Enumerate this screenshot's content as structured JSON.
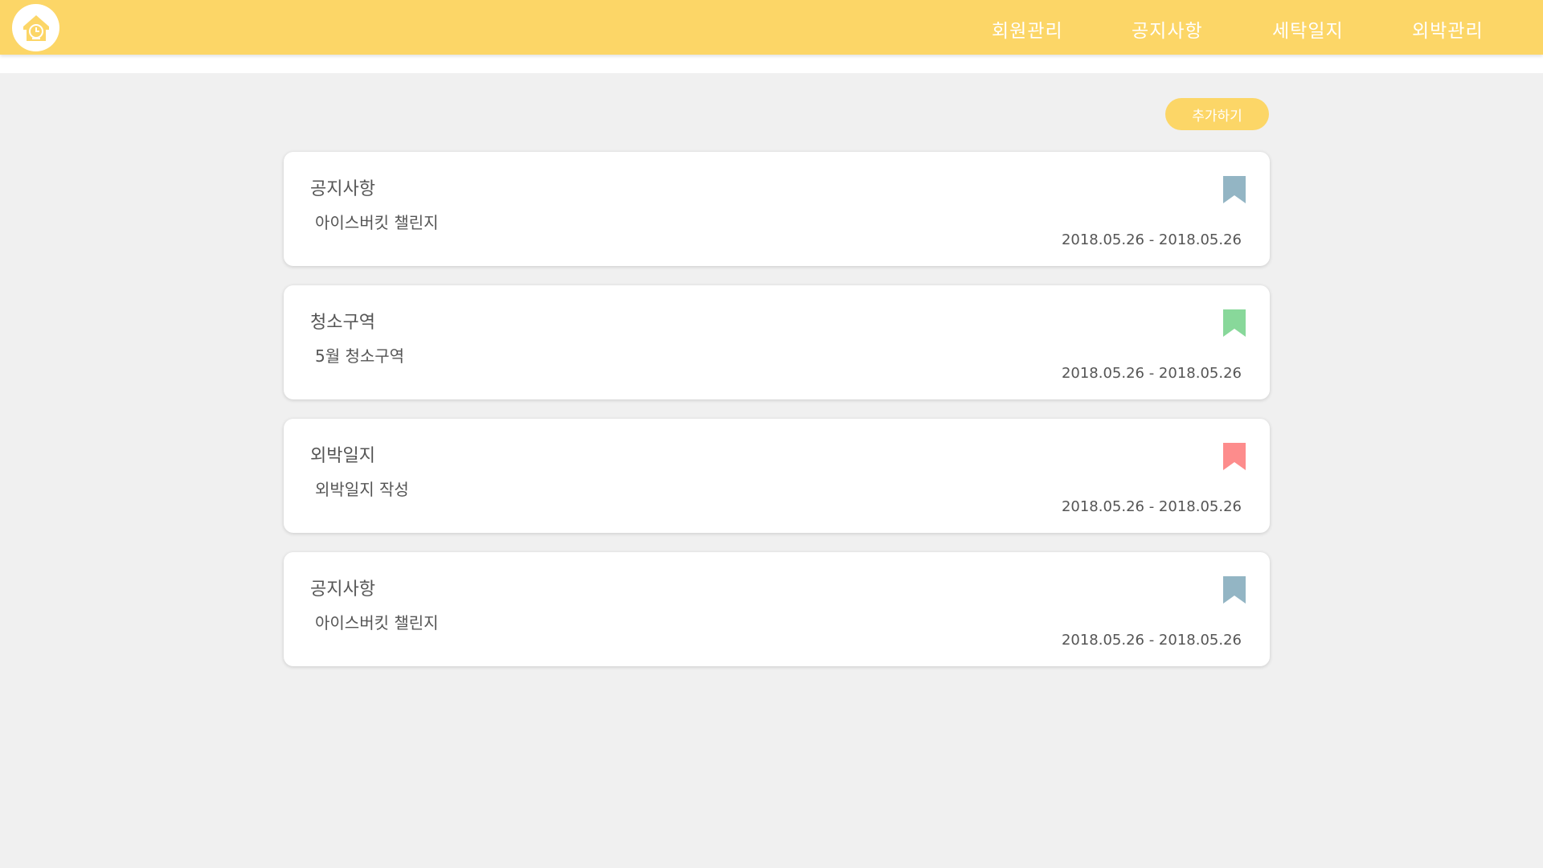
{
  "nav": {
    "items": [
      {
        "label": "회원관리"
      },
      {
        "label": "공지사항"
      },
      {
        "label": "세탁일지"
      },
      {
        "label": "외박관리"
      }
    ]
  },
  "toolbar": {
    "add_label": "추가하기"
  },
  "notices": [
    {
      "title": "공지사항",
      "body": "아이스버킷 챌린지",
      "date": "2018.05.26 - 2018.05.26",
      "color": "#93b5c4",
      "icon": "bookmark-icon"
    },
    {
      "title": "청소구역",
      "body": "5월 청소구역",
      "date": "2018.05.26 - 2018.05.26",
      "color": "#88d89a",
      "icon": "bookmark-icon"
    },
    {
      "title": "외박일지",
      "body": "외박일지 작성",
      "date": "2018.05.26 - 2018.05.26",
      "color": "#fd8c8c",
      "icon": "bookmark-icon"
    },
    {
      "title": "공지사항",
      "body": "아이스버킷 챌린지",
      "date": "2018.05.26 - 2018.05.26",
      "color": "#93b5c4",
      "icon": "bookmark-icon"
    }
  ],
  "colors": {
    "accent": "#fcd667",
    "background": "#f0f0f0"
  }
}
